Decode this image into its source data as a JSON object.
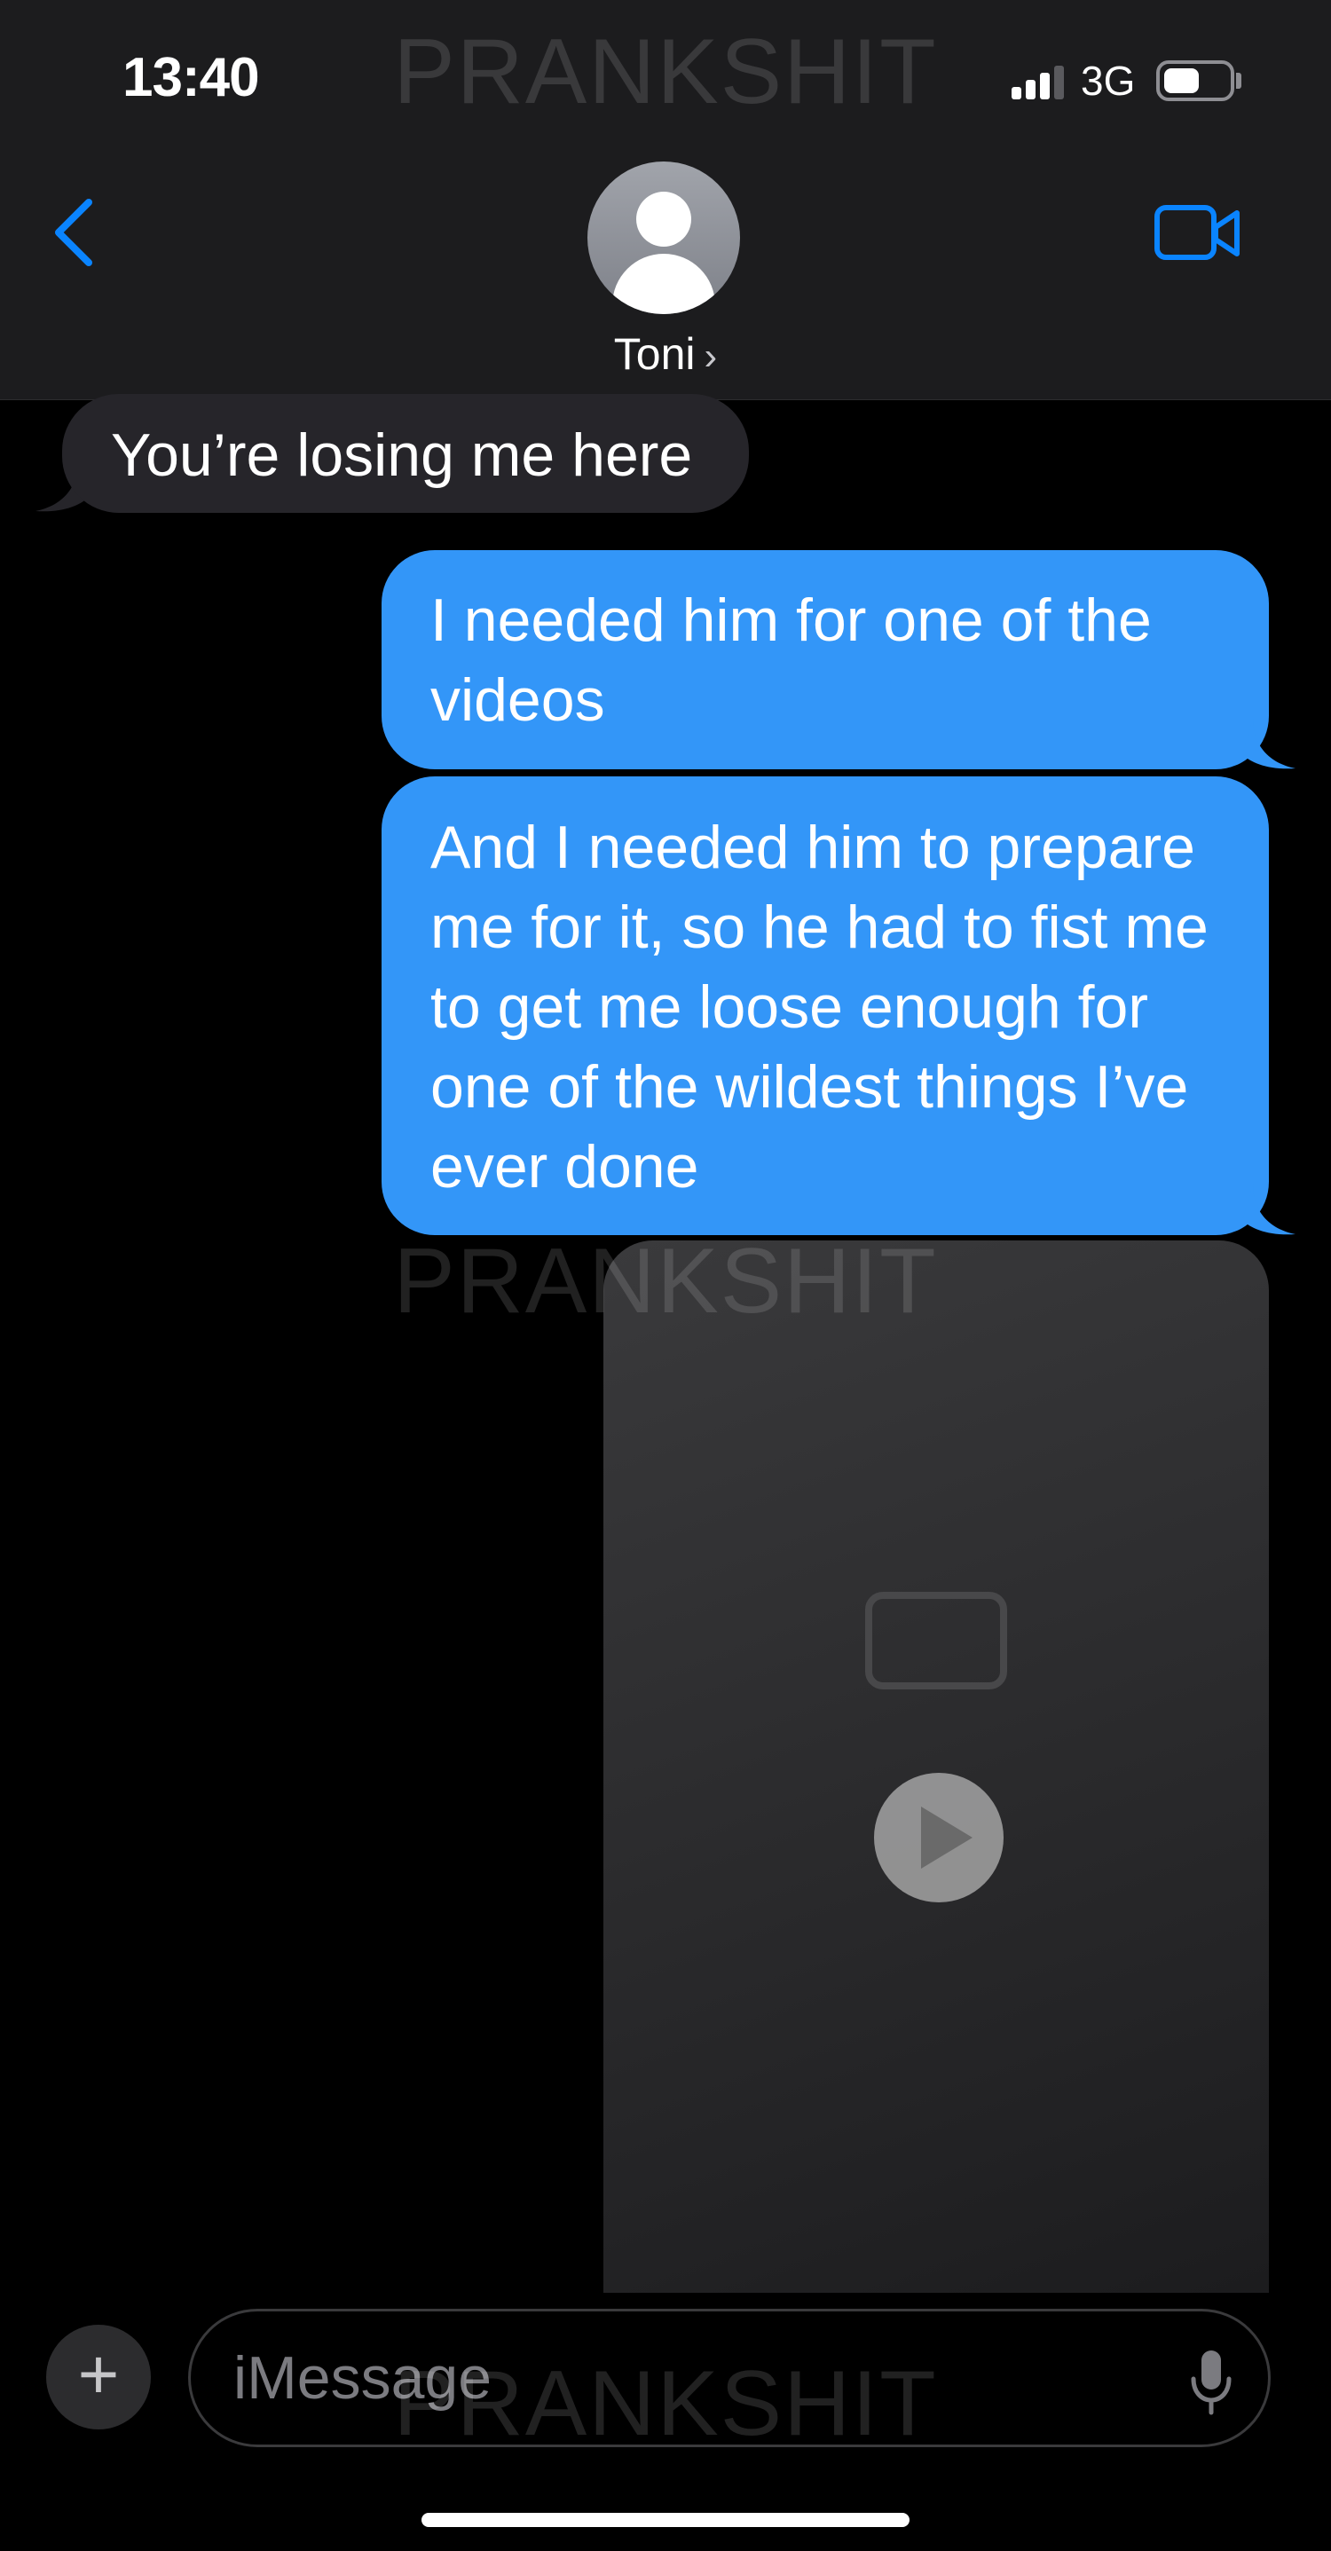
{
  "status_bar": {
    "time": "13:40",
    "network": "3G",
    "battery_level": 0.55
  },
  "header": {
    "contact_name": "Toni",
    "contact_chevron": "›"
  },
  "icons": {
    "back": "chevron-left-icon",
    "video_call": "video-camera-icon",
    "avatar": "person-silhouette-icon",
    "add": "plus-icon",
    "mic": "microphone-icon",
    "play": "play-icon"
  },
  "messages": [
    {
      "direction": "incoming",
      "text": "You’re losing me here"
    },
    {
      "direction": "outgoing",
      "text": "I needed him for one of the videos"
    },
    {
      "direction": "outgoing",
      "text": "And I needed him to prepare me for it, so he had to fist me to get me loose enough for one of the wildest things I’ve ever done"
    },
    {
      "direction": "outgoing",
      "type": "video"
    }
  ],
  "composer": {
    "placeholder": "iMessage",
    "add_symbol": "+"
  },
  "watermark": "PRANKSHIT",
  "colors": {
    "outgoing_bubble": "#3396f8",
    "incoming_bubble": "#26252a",
    "accent": "#0a84ff",
    "nav_background": "#1c1c1e"
  }
}
